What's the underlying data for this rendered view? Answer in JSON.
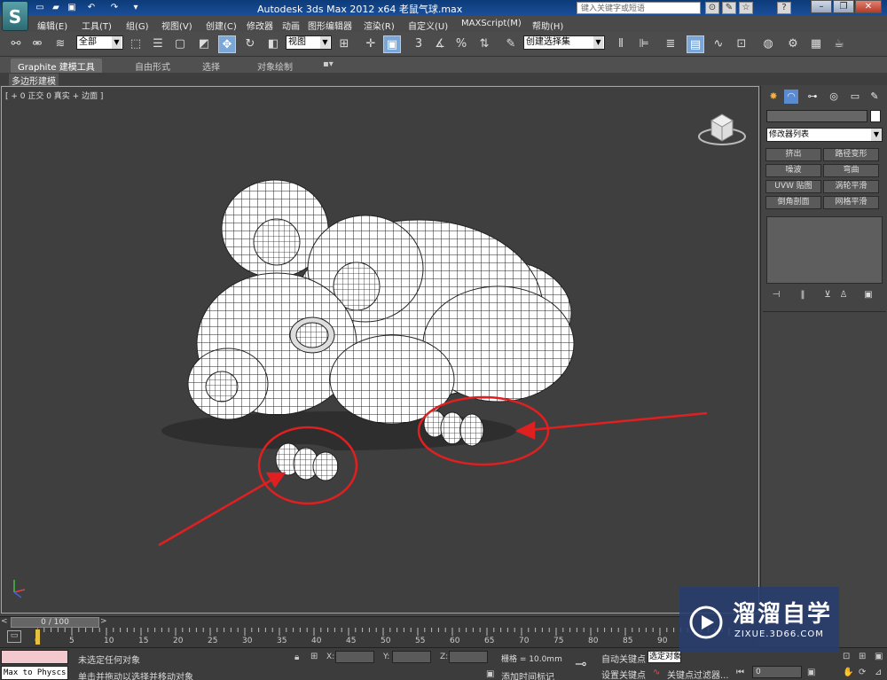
{
  "titlebar": {
    "logo": "S",
    "title": "Autodesk 3ds Max  2012 x64    老鼠气球.max",
    "search_placeholder": "键入关键字或短语",
    "quick_access_icons": [
      "new-file-icon",
      "open-folder-icon",
      "save-icon",
      "undo-icon",
      "redo-icon",
      "dropdown-arrow-icon"
    ],
    "right_icons": [
      "binoculars-icon",
      "tools-icon",
      "star-icon",
      "help-icon"
    ],
    "window_controls": {
      "minimize": "–",
      "restore": "❐",
      "close": "✕"
    }
  },
  "menubar": {
    "items": [
      "编辑(E)",
      "工具(T)",
      "组(G)",
      "视图(V)",
      "创建(C)",
      "修改器",
      "动画",
      "图形编辑器",
      "渲染(R)",
      "自定义(U)",
      "MAXScript(M)",
      "帮助(H)"
    ]
  },
  "maintoolbar": {
    "filter_dropdown": "全部",
    "view_dropdown": "视图",
    "selection_set_dropdown": "创建选择集",
    "snap_label": "3"
  },
  "ribbon": {
    "tabs": [
      "Graphite 建模工具",
      "自由形式",
      "选择",
      "对象绘制"
    ],
    "sub_label": "多边形建模"
  },
  "viewport": {
    "label": "[ + 0 正交 0 真实 + 边面 ]",
    "annotation_color": "#e02020",
    "mesh_color": "#ffffff",
    "wire_color": "#222222",
    "background_color": "#3f3f3f"
  },
  "cmdpanel": {
    "tab_icons": [
      "create-icon",
      "modify-icon",
      "hierarchy-icon",
      "motion-icon",
      "display-icon",
      "utilities-icon"
    ],
    "modifier_list": "修改器列表",
    "modifier_buttons": [
      "挤出",
      "路径变形",
      "噪波",
      "弯曲",
      "UVW 贴图",
      "涡轮平滑",
      "倒角剖面",
      "网格平滑"
    ],
    "stack_tools": [
      "pin-stack-icon",
      "show-end-result-icon",
      "make-unique-icon",
      "remove-modifier-icon",
      "configure-sets-icon"
    ]
  },
  "timeslider": {
    "position": "0 / 100",
    "prev": "<",
    "next": ">"
  },
  "trackbar": {
    "ticks": [
      "0",
      "5",
      "10",
      "15",
      "20",
      "25",
      "30",
      "35",
      "40",
      "45",
      "50",
      "55",
      "60",
      "65",
      "70",
      "75",
      "80",
      "85",
      "90"
    ]
  },
  "statusbar": {
    "maxscript_output": "Max to Physcs",
    "status_line1": "未选定任何对象",
    "status_line2": "单击并拖动以选择并移动对象",
    "coord_x": "X:",
    "coord_y": "Y:",
    "coord_z": "Z:",
    "grid": "栅格 = 10.0mm",
    "add_time_tag": "添加时间标记",
    "auto_key": "自动关键点",
    "set_key": "设置关键点",
    "selected_dropdown": "选定对象",
    "key_filters": "关键点过滤器...",
    "frame": "0"
  },
  "watermark": {
    "title": "溜溜自学",
    "subtitle": "ZIXUE.3D66.COM"
  }
}
